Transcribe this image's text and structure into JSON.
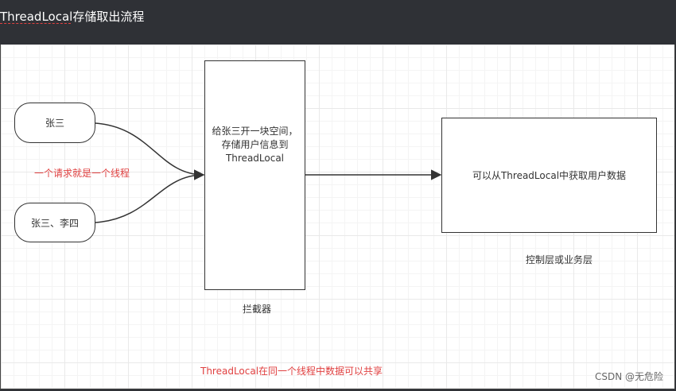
{
  "title": "ThreadLocal存储取出流程",
  "nodes": {
    "user1": "张三",
    "user2": "张三、李四",
    "interceptor_text": [
      "给张三开一块空间，",
      "存储用户信息到",
      "ThreadLocal"
    ],
    "controller_text": "可以从ThreadLocal中获取用户数据"
  },
  "labels": {
    "request_note": "一个请求就是一个线程",
    "interceptor_caption": "拦截器",
    "controller_caption": "控制层或业务层",
    "bottom_note": "ThreadLocal在同一个线程中数据可以共享"
  },
  "watermark": "CSDN @无危险",
  "colors": {
    "note_red": "#e04040",
    "stroke": "#333333",
    "title_bg": "#2f3136"
  }
}
